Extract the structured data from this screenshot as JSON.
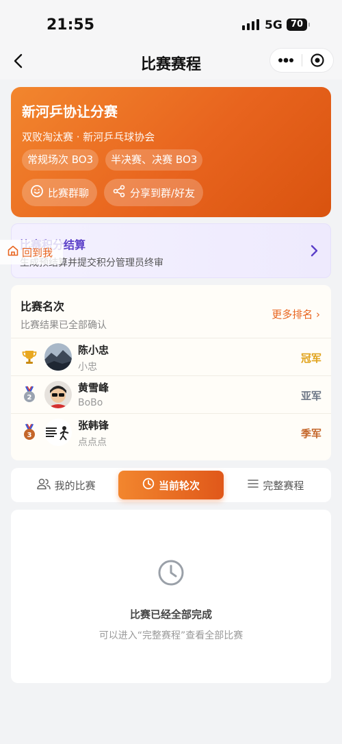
{
  "status_bar": {
    "time": "21:55",
    "network": "5G",
    "battery": "70"
  },
  "nav": {
    "title": "比赛赛程",
    "icons": [
      "back-icon",
      "more-icon",
      "target-icon"
    ]
  },
  "hero": {
    "title": "新河乒协让分赛",
    "subtitle": "双败淘汰赛 · 新河乒乓球协会",
    "tags": [
      "常规场次 BO3",
      "半决赛、决赛 BO3"
    ],
    "actions": [
      {
        "label": "比赛群聊",
        "icon": "chat-icon"
      },
      {
        "label": "分享到群/好友",
        "icon": "share-icon"
      }
    ],
    "colors": {
      "start": "#f2862e",
      "end": "#d9530f"
    }
  },
  "settlement": {
    "title": "比赛积分结算",
    "desc": "生成预结算并提交积分管理员终审",
    "accent": "#5a3fc8"
  },
  "back_to_me": {
    "label": "回到我",
    "icon": "home-icon"
  },
  "ranking": {
    "title": "比赛名次",
    "subtitle": "比赛结果已全部确认",
    "more": "更多排名 ›",
    "rows": [
      {
        "name": "陈小忠",
        "nick": "小忠",
        "place": "冠军",
        "medal": "trophy-icon",
        "color": "#e0a21a"
      },
      {
        "name": "黄雪峰",
        "nick": "BoBo",
        "place": "亚军",
        "medal": "silver-medal-icon",
        "medal_num": "2",
        "color": "#6b7585"
      },
      {
        "name": "张韩锋",
        "nick": "点点点",
        "place": "季军",
        "medal": "bronze-medal-icon",
        "medal_num": "3",
        "color": "#c4662a"
      }
    ]
  },
  "tabs": [
    {
      "label": "我的比赛",
      "icon": "users-icon",
      "active": false
    },
    {
      "label": "当前轮次",
      "icon": "clock-icon",
      "active": true
    },
    {
      "label": "完整赛程",
      "icon": "list-icon",
      "active": false
    }
  ],
  "empty_state": {
    "icon": "clock-icon",
    "title": "比赛已经全部完成",
    "desc": "可以进入“完整赛程”查看全部比赛"
  }
}
